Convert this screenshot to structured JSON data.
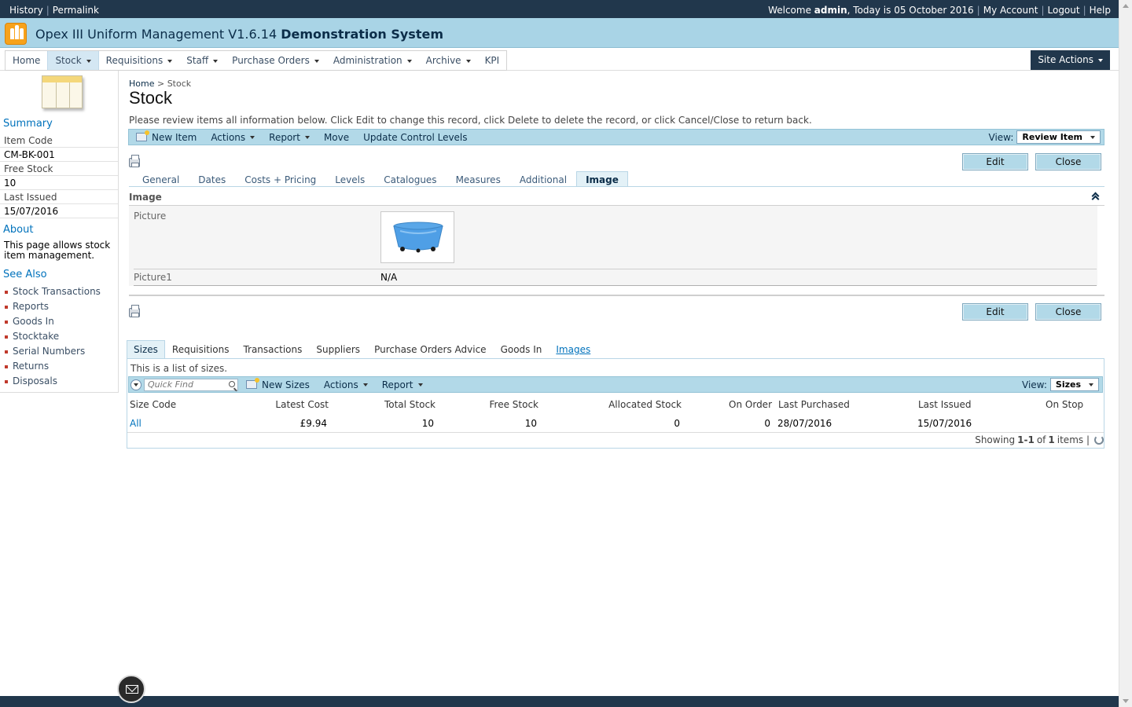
{
  "topbar": {
    "history": "History",
    "permalink": "Permalink",
    "welcome_prefix": "Welcome",
    "user": "admin",
    "today": ", Today is 05 October 2016",
    "my_account": "My Account",
    "logout": "Logout",
    "help": "Help"
  },
  "app": {
    "title": "Opex III Uniform Management V1.6.14",
    "system": "Demonstration System"
  },
  "nav": {
    "items": [
      "Home",
      "Stock",
      "Requisitions",
      "Staff",
      "Purchase Orders",
      "Administration",
      "Archive",
      "KPI"
    ],
    "site_actions": "Site Actions"
  },
  "left": {
    "summary_header": "Summary",
    "item_code_label": "Item Code",
    "item_code": "CM-BK-001",
    "free_stock_label": "Free Stock",
    "free_stock": "10",
    "last_issued_label": "Last Issued",
    "last_issued": "15/07/2016",
    "about_header": "About",
    "about_text": "This page allows stock item management.",
    "see_also_header": "See Also",
    "see_also": [
      "Stock Transactions",
      "Reports",
      "Goods In",
      "Stocktake",
      "Serial Numbers",
      "Returns",
      "Disposals"
    ]
  },
  "breadcrumb": {
    "home": "Home",
    "sep": ">",
    "current": "Stock"
  },
  "page": {
    "title": "Stock",
    "instructions": "Please review items all information below. Click Edit to change this record, click Delete to delete the record, or click Cancel/Close to return back."
  },
  "toolbar1": {
    "new_item": "New Item",
    "actions": "Actions",
    "report": "Report",
    "move": "Move",
    "update_control_levels": "Update Control Levels",
    "view_label": "View:",
    "view_value": "Review Item"
  },
  "buttons": {
    "edit": "Edit",
    "close": "Close"
  },
  "form_tabs": [
    "General",
    "Dates",
    "Costs + Pricing",
    "Levels",
    "Catalogues",
    "Measures",
    "Additional",
    "Image"
  ],
  "image_section": {
    "header": "Image",
    "picture_label": "Picture",
    "picture1_label": "Picture1",
    "picture1_value": "N/A"
  },
  "lower_tabs": [
    "Sizes",
    "Requisitions",
    "Transactions",
    "Suppliers",
    "Purchase Orders Advice",
    "Goods In",
    "Images"
  ],
  "sizes": {
    "note": "This is a list of sizes.",
    "quick_find_placeholder": "Quick Find",
    "new_sizes": "New Sizes",
    "actions": "Actions",
    "report": "Report",
    "view_label": "View:",
    "view_value": "Sizes",
    "columns": [
      "Size Code",
      "Latest Cost",
      "Total Stock",
      "Free Stock",
      "Allocated Stock",
      "On Order",
      "Last Purchased",
      "Last Issued",
      "On Stop"
    ],
    "rows": [
      {
        "size_code": "All",
        "latest_cost": "£9.94",
        "total_stock": "10",
        "free_stock": "10",
        "allocated_stock": "0",
        "on_order": "0",
        "last_purchased": "28/07/2016",
        "last_issued": "15/07/2016",
        "on_stop": ""
      }
    ],
    "paging_prefix": "Showing",
    "paging_range": "1-1",
    "paging_of": "of",
    "paging_total": "1",
    "paging_suffix": "items |"
  },
  "colors": {
    "header_dark": "#21374c",
    "title_bar": "#a9d4e6",
    "toolbar": "#b2d9e8",
    "link": "#0072bc"
  }
}
